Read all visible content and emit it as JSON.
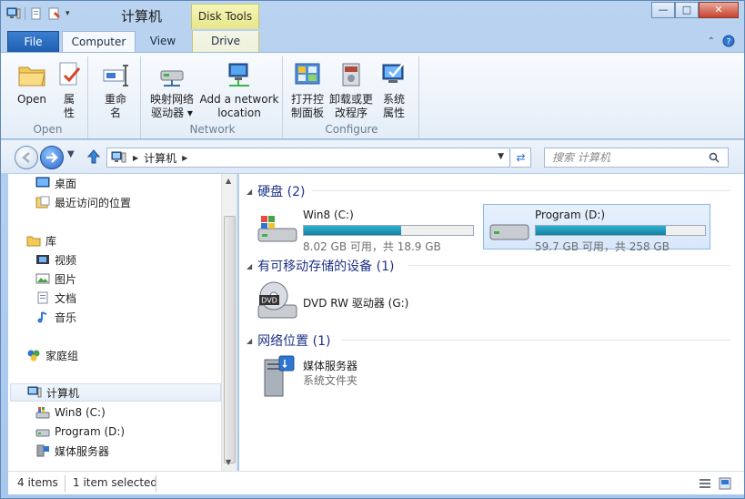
{
  "window": {
    "title": "计算机",
    "context_tab": "Disk Tools",
    "buttons": {
      "minimize": "—",
      "maximize": "□",
      "close": "✕"
    }
  },
  "ribbon_tabs": {
    "file": "File",
    "computer": "Computer",
    "view": "View",
    "drive": "Drive"
  },
  "ribbon": {
    "groups": {
      "open": "Open",
      "network": "Network",
      "configure": "Configure"
    },
    "buttons": {
      "open": "Open",
      "properties_line1": "属",
      "properties_line2": "性",
      "rename_line1": "重命",
      "rename_line2": "名",
      "map_drive_line1": "映射网络",
      "map_drive_line2": "驱动器 ▾",
      "add_location_line1": "Add a network",
      "add_location_line2": "location",
      "control_panel_line1": "打开控",
      "control_panel_line2": "制面板",
      "uninstall_line1": "卸载或更",
      "uninstall_line2": "改程序",
      "system_line1": "系统",
      "system_line2": "属性"
    }
  },
  "address": {
    "path_item": "计算机",
    "search_placeholder": "搜索 计算机"
  },
  "sidebar": {
    "items": [
      {
        "label": "桌面"
      },
      {
        "label": "最近访问的位置"
      },
      {
        "label": "库"
      },
      {
        "label": "视频"
      },
      {
        "label": "图片"
      },
      {
        "label": "文档"
      },
      {
        "label": "音乐"
      },
      {
        "label": "家庭组"
      },
      {
        "label": "计算机"
      },
      {
        "label": "Win8 (C:)"
      },
      {
        "label": "Program (D:)"
      },
      {
        "label": "媒体服务器"
      }
    ]
  },
  "content": {
    "sections": {
      "hard_disks": "硬盘 (2)",
      "removable": "有可移动存储的设备 (1)",
      "network": "网络位置 (1)"
    },
    "drives": [
      {
        "name": "Win8 (C:)",
        "free": "8.02 GB 可用，共 18.9 GB",
        "used_fraction": 0.576
      },
      {
        "name": "Program (D:)",
        "free": "59.7 GB 可用，共 258 GB",
        "used_fraction": 0.769
      }
    ],
    "dvd": {
      "name": "DVD RW 驱动器 (G:)",
      "icon_text": "DVD"
    },
    "media_server": {
      "name": "媒体服务器",
      "type": "系统文件夹"
    }
  },
  "status": {
    "count": "4 items",
    "selected": "1 item selected"
  },
  "colors": {
    "accent": "#1f5fb0",
    "section_heading": "#1e3287",
    "drive_fill": "#13809f",
    "selection": "#d7e8fb"
  }
}
